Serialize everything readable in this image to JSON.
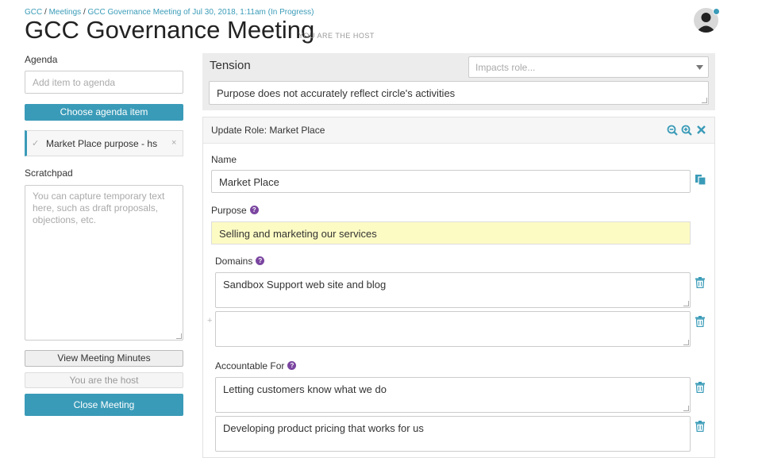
{
  "breadcrumb": {
    "items": [
      "GCC",
      "Meetings",
      "GCC Governance Meeting of Jul 30, 2018, 1:11am (In Progress)"
    ],
    "sep": "/"
  },
  "header": {
    "title": "GCC Governance Meeting",
    "host_tag": "YOU ARE THE HOST"
  },
  "sidebar": {
    "agenda_label": "Agenda",
    "agenda_placeholder": "Add item to agenda",
    "choose_button": "Choose agenda item",
    "agenda_items": [
      {
        "label": "Market Place purpose - hs",
        "close": "×"
      }
    ],
    "scratchpad_label": "Scratchpad",
    "scratchpad_placeholder": "You can capture temporary text here, such as draft proposals, objections, etc.",
    "view_minutes_button": "View Meeting Minutes",
    "host_button": "You are the host",
    "close_meeting_button": "Close Meeting"
  },
  "tension": {
    "label": "Tension",
    "impacts_placeholder": "Impacts role...",
    "text": "Purpose does not accurately reflect circle's activities"
  },
  "update_role": {
    "title": "Update Role: Market Place",
    "name_label": "Name",
    "name_value": "Market Place",
    "purpose_label": "Purpose",
    "purpose_value": "Selling and marketing our services",
    "domains_label": "Domains",
    "domains": [
      "Sandbox Support web site and blog",
      ""
    ],
    "accountable_label": "Accountable For",
    "accountabilities": [
      "Letting customers know what we do",
      "Developing product pricing that works for us"
    ],
    "help_glyph": "?",
    "add_glyph": "+"
  },
  "colors": {
    "accent": "#3a9bb8",
    "purpose_bg": "#fdfbc4",
    "help_badge": "#7a45a0"
  },
  "icons": [
    "zoom-out-icon",
    "zoom-in-icon",
    "close-icon",
    "copy-icon",
    "trash-icon",
    "check-icon",
    "chevron-down-icon",
    "avatar"
  ]
}
